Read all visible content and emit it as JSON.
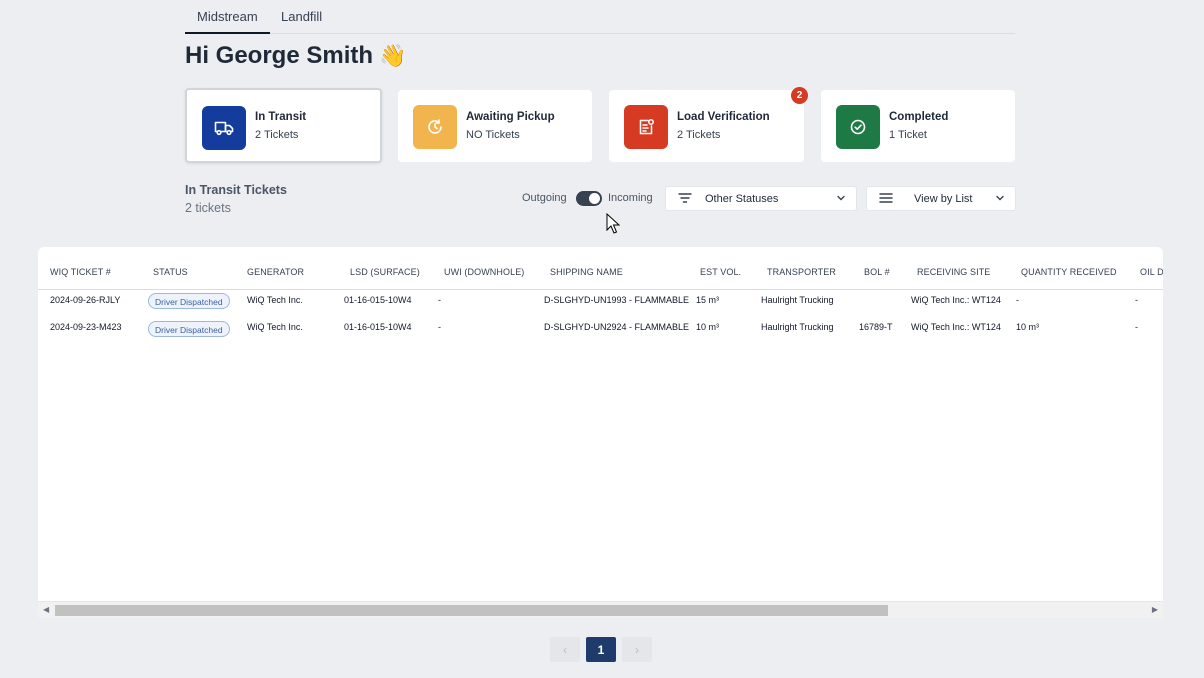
{
  "tabs": [
    {
      "label": "Midstream",
      "active": true
    },
    {
      "label": "Landfill",
      "active": false
    }
  ],
  "greeting": {
    "text": "Hi George Smith",
    "emoji": "👋"
  },
  "cards": [
    {
      "title": "In Transit",
      "subtitle": "2 Tickets",
      "color": "#133c9c",
      "icon": "truck-icon",
      "selected": true
    },
    {
      "title": "Awaiting Pickup",
      "subtitle": "NO Tickets",
      "color": "#f2b44d",
      "icon": "clock-icon"
    },
    {
      "title": "Load Verification",
      "subtitle": "2 Tickets",
      "color": "#d63a22",
      "icon": "document-check-icon",
      "badge": "2"
    },
    {
      "title": "Completed",
      "subtitle": "1 Ticket",
      "color": "#1e7a45",
      "icon": "check-circle-icon"
    }
  ],
  "section": {
    "title": "In Transit Tickets",
    "subtitle": "2 tickets"
  },
  "direction_toggle": {
    "left_label": "Outgoing",
    "right_label": "Incoming",
    "selected": "Incoming"
  },
  "status_filter": {
    "label": "Other Statuses"
  },
  "view_select": {
    "label": "View by List"
  },
  "table": {
    "columns": [
      "WIQ TICKET #",
      "STATUS",
      "GENERATOR",
      "LSD (SURFACE)",
      "UWI (DOWNHOLE)",
      "SHIPPING NAME",
      "EST VOL.",
      "TRANSPORTER",
      "BOL #",
      "RECEIVING SITE",
      "QUANTITY RECEIVED",
      "OIL D"
    ],
    "rows": [
      {
        "ticket": "2024-09-26-RJLY",
        "status": "Driver Dispatched",
        "generator": "WiQ Tech Inc.",
        "lsd": "01-16-015-10W4",
        "uwi": "-",
        "shipping": "D-SLGHYD-UN1993 - FLAMMABLE",
        "est_vol": "15 m³",
        "transporter": "Haulright Trucking",
        "bol": "",
        "receiving": "WiQ Tech Inc.: WT124",
        "qty": "-",
        "oil": "-"
      },
      {
        "ticket": "2024-09-23-M423",
        "status": "Driver Dispatched",
        "generator": "WiQ Tech Inc.",
        "lsd": "01-16-015-10W4",
        "uwi": "-",
        "shipping": "D-SLGHYD-UN2924 - FLAMMABLE",
        "est_vol": "10 m³",
        "transporter": "Haulright Trucking",
        "bol": "16789-T",
        "receiving": "WiQ Tech Inc.: WT124",
        "qty": "10 m³",
        "oil": "-"
      }
    ]
  },
  "pagination": {
    "prev": "‹",
    "current": "1",
    "next": "›"
  }
}
